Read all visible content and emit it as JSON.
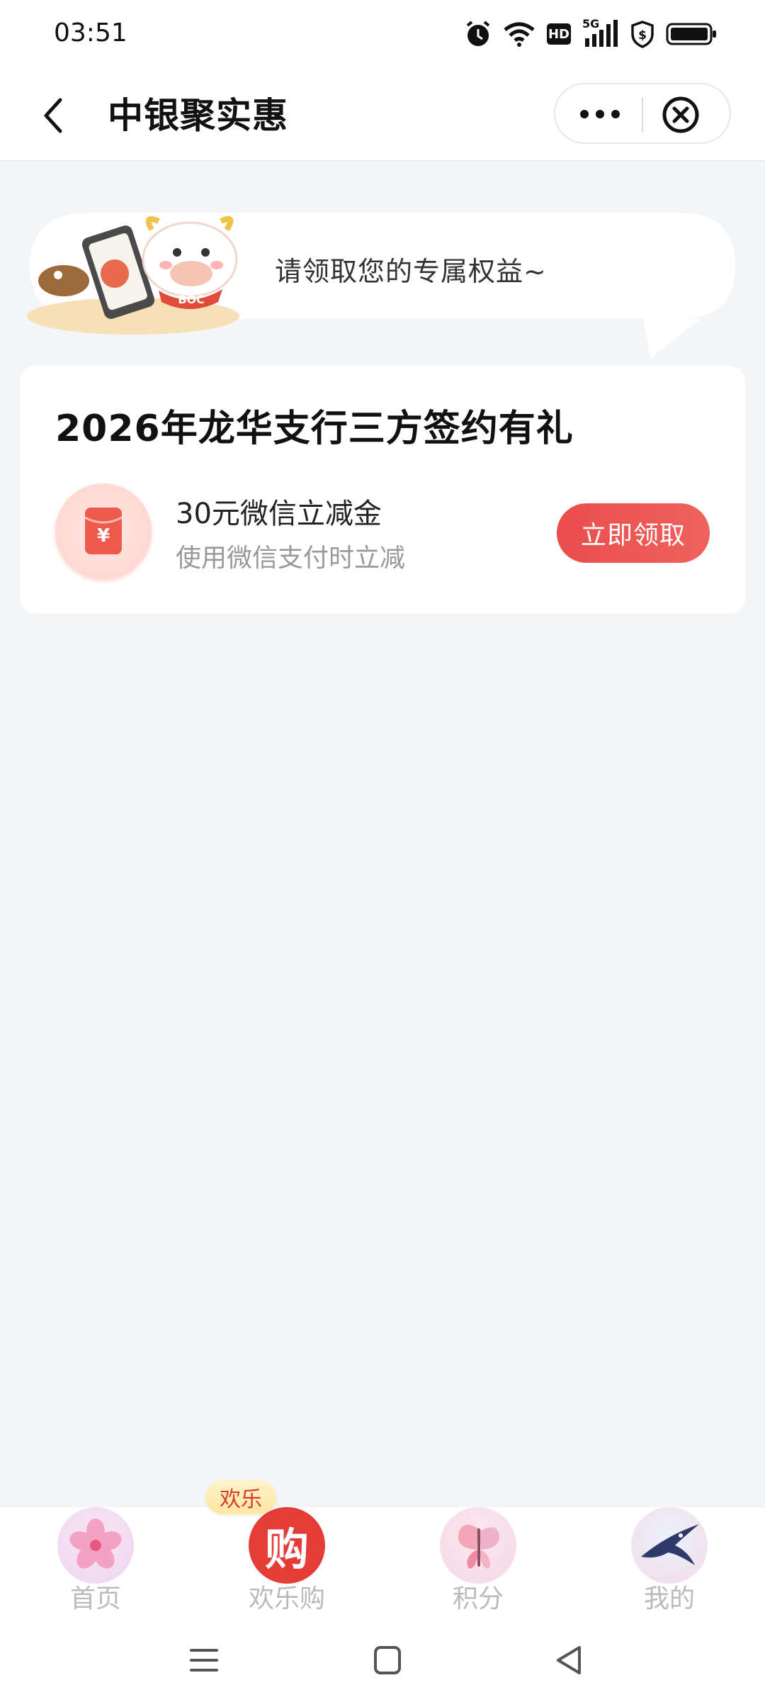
{
  "status_bar": {
    "time": "03:51",
    "icons": [
      "alarm-icon",
      "wifi-icon",
      "hd-icon",
      "5g-signal-icon",
      "shield-icon",
      "battery-icon"
    ],
    "hd": "HD",
    "net": "5G"
  },
  "header": {
    "title": "中银聚实惠",
    "back_icon": "chevron-left-icon",
    "more_icon": "more-dots-icon",
    "close_icon": "close-circle-icon"
  },
  "banner": {
    "text": "请领取您的专属权益~",
    "mascot_text": "BOC"
  },
  "card": {
    "title": "2026年龙华支行三方签约有礼",
    "coupon": {
      "icon": "red-envelope-icon",
      "symbol": "¥",
      "name": "30元微信立减金",
      "desc": "使用微信支付时立减",
      "button": "立即领取"
    }
  },
  "tabbar": {
    "badge": "欢乐",
    "tabs": [
      {
        "label": "首页",
        "icon": "flower-icon"
      },
      {
        "label": "欢乐购",
        "icon": "shopping-icon",
        "glyph": "购"
      },
      {
        "label": "积分",
        "icon": "butterfly-icon"
      },
      {
        "label": "我的",
        "icon": "swallow-icon"
      }
    ]
  },
  "system_nav": {
    "icons": [
      "menu-icon",
      "home-square-icon",
      "back-triangle-icon"
    ]
  },
  "colors": {
    "accent": "#ea4d4d",
    "background": "#f4f5f7",
    "muted_text": "#999999"
  }
}
